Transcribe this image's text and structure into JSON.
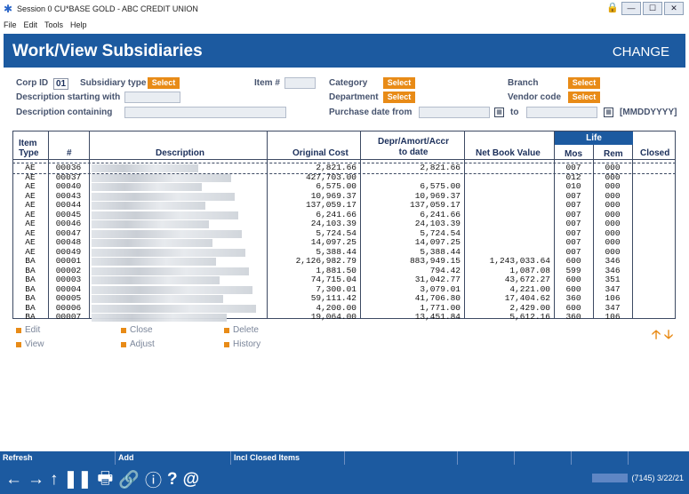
{
  "window": {
    "title": "Session 0 CU*BASE GOLD - ABC CREDIT UNION"
  },
  "menu": [
    "File",
    "Edit",
    "Tools",
    "Help"
  ],
  "header": {
    "title": "Work/View Subsidiaries",
    "mode": "CHANGE"
  },
  "filters": {
    "corp_id_label": "Corp ID",
    "corp_id_value": "01",
    "subsidiary_type_label": "Subsidiary type",
    "item_label": "Item #",
    "category_label": "Category",
    "branch_label": "Branch",
    "department_label": "Department",
    "vendor_code_label": "Vendor code",
    "desc_start_label": "Description starting with",
    "desc_contain_label": "Description containing",
    "purchase_from_label": "Purchase date from",
    "to_label": "to",
    "date_format": "[MMDDYYYY]",
    "select_label": "Select"
  },
  "table": {
    "headers": {
      "item_type": "Item Type",
      "num": "#",
      "description": "Description",
      "original_cost": "Original Cost",
      "depr": "Depr/Amort/Accr to date",
      "net_book_value": "Net Book Value",
      "life": "Life",
      "mos": "Mos",
      "rem": "Rem",
      "closed": "Closed"
    },
    "rows": [
      {
        "type": "AE",
        "num": "00036",
        "cost": "2,821.66",
        "depr": "2,821.66",
        "nbv": "",
        "mos": "007",
        "rem": "000",
        "closed": ""
      },
      {
        "type": "AE",
        "num": "00037",
        "cost": "427,703.00",
        "depr": "",
        "nbv": "",
        "mos": "012",
        "rem": "000",
        "closed": ""
      },
      {
        "type": "AE",
        "num": "00040",
        "cost": "6,575.00",
        "depr": "6,575.00",
        "nbv": "",
        "mos": "010",
        "rem": "000",
        "closed": ""
      },
      {
        "type": "AE",
        "num": "00043",
        "cost": "10,969.37",
        "depr": "10,969.37",
        "nbv": "",
        "mos": "007",
        "rem": "000",
        "closed": ""
      },
      {
        "type": "AE",
        "num": "00044",
        "cost": "137,059.17",
        "depr": "137,059.17",
        "nbv": "",
        "mos": "007",
        "rem": "000",
        "closed": ""
      },
      {
        "type": "AE",
        "num": "00045",
        "cost": "6,241.66",
        "depr": "6,241.66",
        "nbv": "",
        "mos": "007",
        "rem": "000",
        "closed": ""
      },
      {
        "type": "AE",
        "num": "00046",
        "cost": "24,103.39",
        "depr": "24,103.39",
        "nbv": "",
        "mos": "007",
        "rem": "000",
        "closed": ""
      },
      {
        "type": "AE",
        "num": "00047",
        "cost": "5,724.54",
        "depr": "5,724.54",
        "nbv": "",
        "mos": "007",
        "rem": "000",
        "closed": ""
      },
      {
        "type": "AE",
        "num": "00048",
        "cost": "14,097.25",
        "depr": "14,097.25",
        "nbv": "",
        "mos": "007",
        "rem": "000",
        "closed": ""
      },
      {
        "type": "AE",
        "num": "00049",
        "cost": "5,388.44",
        "depr": "5,388.44",
        "nbv": "",
        "mos": "007",
        "rem": "000",
        "closed": ""
      },
      {
        "type": "BA",
        "num": "00001",
        "cost": "2,126,982.79",
        "depr": "883,949.15",
        "nbv": "1,243,033.64",
        "mos": "600",
        "rem": "346",
        "closed": ""
      },
      {
        "type": "BA",
        "num": "00002",
        "cost": "1,881.50",
        "depr": "794.42",
        "nbv": "1,087.08",
        "mos": "599",
        "rem": "346",
        "closed": ""
      },
      {
        "type": "BA",
        "num": "00003",
        "cost": "74,715.04",
        "depr": "31,042.77",
        "nbv": "43,672.27",
        "mos": "600",
        "rem": "351",
        "closed": ""
      },
      {
        "type": "BA",
        "num": "00004",
        "cost": "7,300.01",
        "depr": "3,079.01",
        "nbv": "4,221.00",
        "mos": "600",
        "rem": "347",
        "closed": ""
      },
      {
        "type": "BA",
        "num": "00005",
        "cost": "59,111.42",
        "depr": "41,706.80",
        "nbv": "17,404.62",
        "mos": "360",
        "rem": "106",
        "closed": ""
      },
      {
        "type": "BA",
        "num": "00006",
        "cost": "4,200.00",
        "depr": "1,771.00",
        "nbv": "2,429.00",
        "mos": "600",
        "rem": "347",
        "closed": ""
      },
      {
        "type": "BA",
        "num": "00007",
        "cost": "19,064.00",
        "depr": "13,451.84",
        "nbv": "5,612.16",
        "mos": "360",
        "rem": "106",
        "closed": ""
      }
    ]
  },
  "actions": [
    {
      "label": "Edit"
    },
    {
      "label": "Close"
    },
    {
      "label": "Delete"
    },
    {
      "label": "View"
    },
    {
      "label": "Adjust"
    },
    {
      "label": "History"
    }
  ],
  "fkeys": [
    "Refresh",
    "Add",
    "Incl Closed Items",
    "",
    "",
    "",
    "",
    ""
  ],
  "status": {
    "text": "(7145) 3/22/21"
  },
  "colors": {
    "primary": "#1c5aa0",
    "accent": "#e88b17"
  }
}
